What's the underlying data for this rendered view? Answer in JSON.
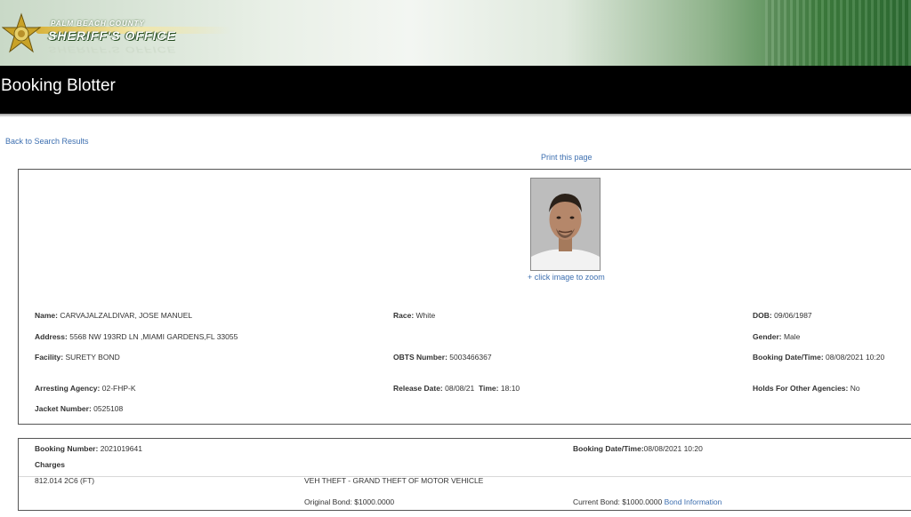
{
  "header": {
    "org_sub": "PALM BEACH COUNTY",
    "org_main": "SHERIFF'S OFFICE",
    "page_title": "Booking Blotter"
  },
  "links": {
    "back": "Back to Search Results",
    "print": "Print this page",
    "zoom": "+ click image to zoom",
    "bond_info": "Bond Information"
  },
  "inmate": {
    "name_label": "Name:",
    "name": "CARVAJALZALDIVAR, JOSE MANUEL",
    "race_label": "Race:",
    "race": "White",
    "dob_label": "DOB:",
    "dob": "09/06/1987",
    "address_label": "Address:",
    "address": "5568 NW 193RD LN ,MIAMI GARDENS,FL 33055",
    "gender_label": "Gender:",
    "gender": "Male",
    "facility_label": "Facility:",
    "facility": "SURETY BOND",
    "obts_label": "OBTS Number:",
    "obts": "5003466367",
    "booking_dt_label": "Booking Date/Time:",
    "booking_dt": "08/08/2021 10:20",
    "agency_label": "Arresting Agency:",
    "agency": "02-FHP-K",
    "release_label": "Release Date:",
    "release_date": "08/08/21",
    "time_label": "Time:",
    "release_time": "18:10",
    "holds_label": "Holds For Other Agencies:",
    "holds": "No",
    "jacket_label": "Jacket Number:",
    "jacket": "0525108"
  },
  "booking": {
    "number_label": "Booking Number:",
    "number": "2021019641",
    "dt_label": "Booking Date/Time:",
    "dt": "08/08/2021 10:20",
    "charges_label": "Charges",
    "charges": [
      {
        "statute": "812.014 2C6 (FT)",
        "description": "VEH THEFT - GRAND THEFT OF MOTOR VEHICLE",
        "original_bond_label": "Original Bond:",
        "original_bond": "$1000.0000",
        "current_bond_label": "Current Bond:",
        "current_bond": "$1000.0000"
      }
    ]
  },
  "colors": {
    "link": "#3d6fb0",
    "title_bar": "#000000",
    "banner_green": "#2e6e33"
  }
}
